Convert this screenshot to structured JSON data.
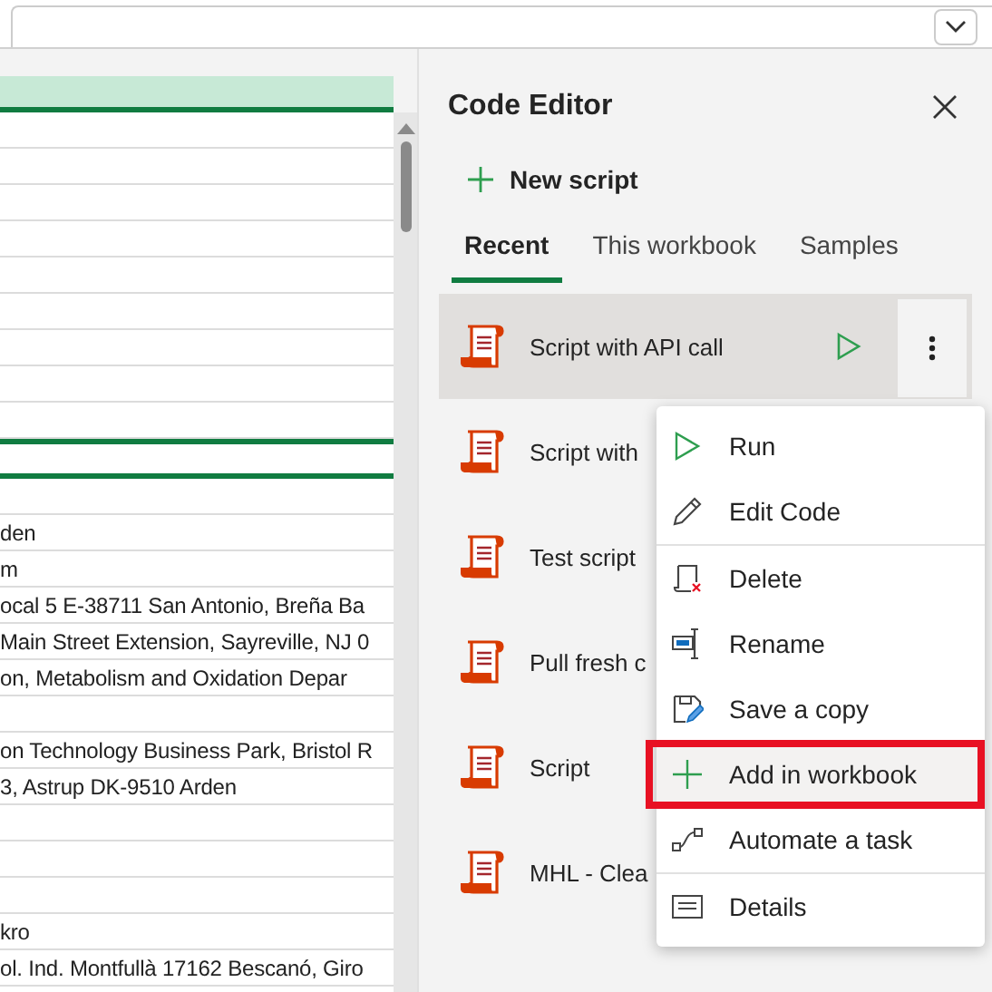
{
  "sheet": {
    "rows": [
      {
        "kind": "plain"
      },
      {
        "kind": "plain"
      },
      {
        "kind": "plain"
      },
      {
        "kind": "plain"
      },
      {
        "kind": "plain"
      },
      {
        "kind": "plain"
      },
      {
        "kind": "plain"
      },
      {
        "kind": "plain"
      },
      {
        "kind": "plain"
      },
      {
        "kind": "outlined"
      },
      {
        "kind": "plain"
      },
      {
        "kind": "plain",
        "cell": "den"
      },
      {
        "kind": "plain",
        "cell": "m"
      },
      {
        "kind": "plain",
        "cell": "ocal 5 E-38711 San Antonio, Breña Ba"
      },
      {
        "kind": "plain",
        "cell": "Main Street Extension, Sayreville, NJ  0"
      },
      {
        "kind": "plain",
        "cell": "on, Metabolism and Oxidation  Depar"
      },
      {
        "kind": "plain"
      },
      {
        "kind": "plain",
        "cell": "on Technology Business Park, Bristol R"
      },
      {
        "kind": "plain",
        "cell": "3, Astrup DK-9510 Arden"
      },
      {
        "kind": "plain"
      },
      {
        "kind": "plain"
      },
      {
        "kind": "plain"
      },
      {
        "kind": "plain",
        "cell": "kro"
      },
      {
        "kind": "plain",
        "cell": "ol. Ind. Montfullà 17162 Bescanó, Giro"
      }
    ]
  },
  "panel": {
    "title": "Code Editor",
    "new_script": "New script",
    "tabs": [
      {
        "label": "Recent",
        "selected": true
      },
      {
        "label": "This workbook",
        "selected": false
      },
      {
        "label": "Samples",
        "selected": false
      }
    ],
    "scripts": [
      {
        "name": "Script with API call",
        "selected": true
      },
      {
        "name": "Script with",
        "selected": false
      },
      {
        "name": "Test script",
        "selected": false
      },
      {
        "name": "Pull fresh c",
        "selected": false
      },
      {
        "name": "Script",
        "selected": false
      },
      {
        "name": "MHL - Clea",
        "selected": false
      }
    ]
  },
  "menu": {
    "items": [
      {
        "kind": "run",
        "label": "Run",
        "highlighted": false,
        "divider_after": false
      },
      {
        "kind": "edit",
        "label": "Edit Code",
        "highlighted": false,
        "divider_after": true
      },
      {
        "kind": "delete",
        "label": "Delete",
        "highlighted": false,
        "divider_after": false
      },
      {
        "kind": "rename",
        "label": "Rename",
        "highlighted": false,
        "divider_after": false
      },
      {
        "kind": "save",
        "label": "Save a copy",
        "highlighted": false,
        "divider_after": false
      },
      {
        "kind": "add",
        "label": "Add in workbook",
        "highlighted": true,
        "divider_after": false
      },
      {
        "kind": "automate",
        "label": "Automate a task",
        "highlighted": false,
        "divider_after": true
      },
      {
        "kind": "details",
        "label": "Details",
        "highlighted": false,
        "divider_after": false
      }
    ]
  }
}
